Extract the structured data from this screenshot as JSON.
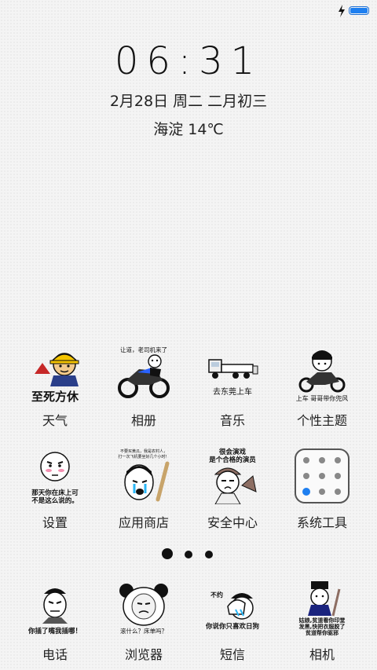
{
  "status_bar": {
    "battery_level": 1.0,
    "charging": true,
    "accent": "#1e7ff0"
  },
  "lock": {
    "time": "06:31",
    "date": "2月28日 周二 二月初三",
    "weather": "海淀 14℃"
  },
  "home_rows": [
    [
      {
        "label": "天气",
        "icon": "hardhat-meme-icon",
        "caption": "至死方休"
      },
      {
        "label": "相册",
        "icon": "motorbike-meme-icon",
        "caption": "让道，老司机来了"
      },
      {
        "label": "音乐",
        "icon": "truck-meme-icon",
        "caption": "去东莞上车"
      },
      {
        "label": "个性主题",
        "icon": "bowlcut-motorbike-meme-icon",
        "caption": "上车 哥哥带你兜风"
      }
    ],
    [
      {
        "label": "设置",
        "icon": "blush-face-meme-icon",
        "caption1": "那天你在床上可",
        "caption2": "不是这么说的。"
      },
      {
        "label": "应用商店",
        "icon": "crying-villager-meme-icon",
        "caption1": "不要买黄瓜，我是农村人，",
        "caption2": "打一次飞机要坐好几个小时！"
      },
      {
        "label": "安全中心",
        "icon": "actor-meme-icon",
        "caption1": "很会演戏",
        "caption2": "是个合格的演员"
      },
      {
        "label": "系统工具",
        "icon": "tools-folder-icon"
      }
    ]
  ],
  "pager": {
    "pages": 3,
    "current": 1
  },
  "dock": [
    {
      "label": "电话",
      "icon": "phone-meme-icon",
      "caption": "你插了嘴我插哪！"
    },
    {
      "label": "浏览器",
      "icon": "panda-meme-icon",
      "caption": "滚什么？床单吗？"
    },
    {
      "label": "短信",
      "icon": "facepalm-meme-icon",
      "caption0": "不约",
      "caption": "你说你只喜欢日狗"
    },
    {
      "label": "相机",
      "icon": "officer-meme-icon",
      "caption1": "姑娘,贫道看你印堂",
      "caption2": "发黑,快把衣服脱了",
      "caption3": "贫道帮你驱邪"
    }
  ]
}
